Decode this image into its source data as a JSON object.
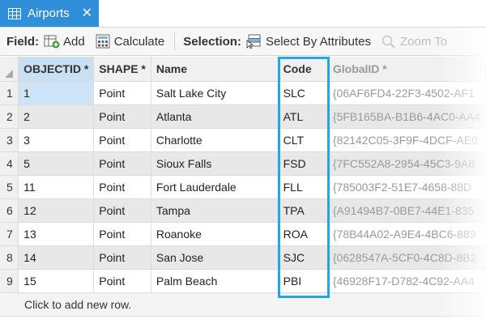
{
  "tab": {
    "title": "Airports",
    "close_glyph": "✕",
    "icon": "table-icon"
  },
  "toolbar": {
    "field_label": "Field:",
    "add_label": "Add",
    "calculate_label": "Calculate",
    "selection_label": "Selection:",
    "select_by_attributes_label": "Select By Attributes",
    "zoom_to_label": "Zoom To"
  },
  "table": {
    "columns": [
      "OBJECTID *",
      "SHAPE *",
      "Name",
      "Code",
      "GlobalID *"
    ],
    "rows": [
      {
        "row": "1",
        "objectid": "1",
        "shape": "Point",
        "name": "Salt Lake City",
        "code": "SLC",
        "globalid": "{06AF6FD4-22F3-4502-AF1"
      },
      {
        "row": "2",
        "objectid": "2",
        "shape": "Point",
        "name": "Atlanta",
        "code": "ATL",
        "globalid": "{5FB165BA-B1B6-4AC0-AA4"
      },
      {
        "row": "3",
        "objectid": "3",
        "shape": "Point",
        "name": "Charlotte",
        "code": "CLT",
        "globalid": "{82142C05-3F9F-4DCF-AE0"
      },
      {
        "row": "4",
        "objectid": "5",
        "shape": "Point",
        "name": "Sioux Falls",
        "code": "FSD",
        "globalid": "{7FC552A8-2954-45C3-9A8"
      },
      {
        "row": "5",
        "objectid": "11",
        "shape": "Point",
        "name": "Fort Lauderdale",
        "code": "FLL",
        "globalid": "{785003F2-51E7-4658-88D"
      },
      {
        "row": "6",
        "objectid": "12",
        "shape": "Point",
        "name": "Tampa",
        "code": "TPA",
        "globalid": "{A91494B7-0BE7-44E1-835"
      },
      {
        "row": "7",
        "objectid": "13",
        "shape": "Point",
        "name": "Roanoke",
        "code": "ROA",
        "globalid": "{78B44A02-A9E4-4BC6-889"
      },
      {
        "row": "8",
        "objectid": "14",
        "shape": "Point",
        "name": "San Jose",
        "code": "SJC",
        "globalid": "{0628547A-5CF0-4C8D-8B2"
      },
      {
        "row": "9",
        "objectid": "15",
        "shape": "Point",
        "name": "Palm Beach",
        "code": "PBI",
        "globalid": "{46928F17-D782-4C92-AA4"
      }
    ],
    "add_row_text": "Click to add new row."
  },
  "colors": {
    "tab": "#2f8fd8",
    "highlight": "#1fa9e0",
    "selected_cell": "#cde4f7"
  }
}
